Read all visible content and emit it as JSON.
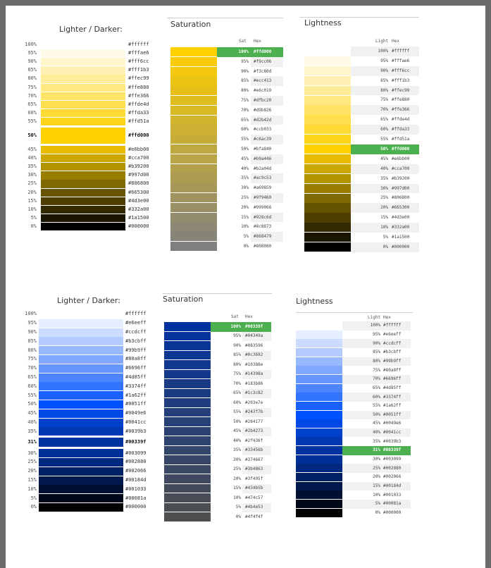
{
  "sections": [
    {
      "scale": {
        "title": "Lighter / Darker:",
        "selected": 10,
        "rows": [
          {
            "label": "100%",
            "hex": "#ffffff"
          },
          {
            "label": "95%",
            "hex": "#fffae6"
          },
          {
            "label": "90%",
            "hex": "#fff6cc"
          },
          {
            "label": "85%",
            "hex": "#fff1b3"
          },
          {
            "label": "80%",
            "hex": "#ffec99"
          },
          {
            "label": "75%",
            "hex": "#ffe880"
          },
          {
            "label": "70%",
            "hex": "#ffe366"
          },
          {
            "label": "65%",
            "hex": "#ffde4d"
          },
          {
            "label": "60%",
            "hex": "#ffda33"
          },
          {
            "label": "55%",
            "hex": "#ffd51a"
          },
          {
            "label": "50%",
            "hex": "#ffd000"
          },
          {
            "label": "45%",
            "hex": "#e6bb00"
          },
          {
            "label": "40%",
            "hex": "#cca700"
          },
          {
            "label": "35%",
            "hex": "#b39200"
          },
          {
            "label": "30%",
            "hex": "#997d00"
          },
          {
            "label": "25%",
            "hex": "#806800"
          },
          {
            "label": "20%",
            "hex": "#665300"
          },
          {
            "label": "15%",
            "hex": "#4d3e00"
          },
          {
            "label": "10%",
            "hex": "#332a00"
          },
          {
            "label": "5%",
            "hex": "#1a1500"
          },
          {
            "label": "0%",
            "hex": "#000000"
          }
        ]
      },
      "saturation": {
        "title": "Saturation",
        "col_pct": "Sat",
        "col_hex": "Hex",
        "selected": 0,
        "rows": [
          {
            "pct": "100%",
            "hex": "#ffd000",
            "color": "#ffd000"
          },
          {
            "pct": "95%",
            "hex": "#f9cc06",
            "color": "#f9cc06"
          },
          {
            "pct": "90%",
            "hex": "#f3c80d",
            "color": "#f3c80d"
          },
          {
            "pct": "85%",
            "hex": "#ecc413",
            "color": "#ecc413"
          },
          {
            "pct": "80%",
            "hex": "#e6c019",
            "color": "#e6c019"
          },
          {
            "pct": "75%",
            "hex": "#dfbc20",
            "color": "#dfbc20"
          },
          {
            "pct": "70%",
            "hex": "#d9b826",
            "color": "#d9b826"
          },
          {
            "pct": "65%",
            "hex": "#d2b42d",
            "color": "#d2b42d"
          },
          {
            "pct": "60%",
            "hex": "#ccb033",
            "color": "#ccb033"
          },
          {
            "pct": "55%",
            "hex": "#c6ac39",
            "color": "#c6ac39"
          },
          {
            "pct": "50%",
            "hex": "#bfa840",
            "color": "#bfa840"
          },
          {
            "pct": "45%",
            "hex": "#b9a446",
            "color": "#b9a446"
          },
          {
            "pct": "40%",
            "hex": "#b2a04d",
            "color": "#b2a04d"
          },
          {
            "pct": "35%",
            "hex": "#ac9c53",
            "color": "#ac9c53"
          },
          {
            "pct": "30%",
            "hex": "#a69859",
            "color": "#a69859"
          },
          {
            "pct": "25%",
            "hex": "#9f9460",
            "color": "#9f9460"
          },
          {
            "pct": "20%",
            "hex": "#999066",
            "color": "#999066"
          },
          {
            "pct": "15%",
            "hex": "#928c6d",
            "color": "#928c6d"
          },
          {
            "pct": "10%",
            "hex": "#8c8873",
            "color": "#8c8873"
          },
          {
            "pct": "5%",
            "hex": "#868479",
            "color": "#868479"
          },
          {
            "pct": "0%",
            "hex": "#808080",
            "color": "#808080"
          }
        ]
      },
      "lightness": {
        "title": "Lightness",
        "col_pct": "Light",
        "col_hex": "Hex",
        "selected": 10,
        "rows": [
          {
            "pct": "100%",
            "hex": "#ffffff"
          },
          {
            "pct": "95%",
            "hex": "#fffae6"
          },
          {
            "pct": "90%",
            "hex": "#fff6cc"
          },
          {
            "pct": "85%",
            "hex": "#fff1b3"
          },
          {
            "pct": "80%",
            "hex": "#ffec99"
          },
          {
            "pct": "75%",
            "hex": "#ffe880"
          },
          {
            "pct": "70%",
            "hex": "#ffe366"
          },
          {
            "pct": "65%",
            "hex": "#ffde4d"
          },
          {
            "pct": "60%",
            "hex": "#ffda33"
          },
          {
            "pct": "55%",
            "hex": "#ffd51a"
          },
          {
            "pct": "50%",
            "hex": "#ffd000"
          },
          {
            "pct": "45%",
            "hex": "#e6bb00"
          },
          {
            "pct": "40%",
            "hex": "#cca700"
          },
          {
            "pct": "35%",
            "hex": "#b39200"
          },
          {
            "pct": "30%",
            "hex": "#997d00"
          },
          {
            "pct": "25%",
            "hex": "#806800"
          },
          {
            "pct": "20%",
            "hex": "#665300"
          },
          {
            "pct": "15%",
            "hex": "#4d3e00"
          },
          {
            "pct": "10%",
            "hex": "#332a00"
          },
          {
            "pct": "5%",
            "hex": "#1a1500"
          },
          {
            "pct": "0%",
            "hex": "#000000"
          }
        ]
      }
    },
    {
      "scale": {
        "title": "Lighter / Darker:",
        "selected": 14,
        "rows": [
          {
            "label": "100%",
            "hex": "#ffffff"
          },
          {
            "label": "95%",
            "hex": "#e6eeff"
          },
          {
            "label": "90%",
            "hex": "#ccdcff"
          },
          {
            "label": "85%",
            "hex": "#b3cbff"
          },
          {
            "label": "80%",
            "hex": "#99b9ff"
          },
          {
            "label": "75%",
            "hex": "#80a8ff"
          },
          {
            "label": "70%",
            "hex": "#6696ff"
          },
          {
            "label": "65%",
            "hex": "#4d85ff"
          },
          {
            "label": "60%",
            "hex": "#3374ff"
          },
          {
            "label": "55%",
            "hex": "#1a62ff"
          },
          {
            "label": "50%",
            "hex": "#0051ff"
          },
          {
            "label": "45%",
            "hex": "#0049e6"
          },
          {
            "label": "40%",
            "hex": "#0041cc"
          },
          {
            "label": "35%",
            "hex": "#0039b3"
          },
          {
            "label": "31%",
            "hex": "#00339f"
          },
          {
            "label": "30%",
            "hex": "#003099"
          },
          {
            "label": "25%",
            "hex": "#002880"
          },
          {
            "label": "20%",
            "hex": "#002066"
          },
          {
            "label": "15%",
            "hex": "#00184d"
          },
          {
            "label": "10%",
            "hex": "#001033"
          },
          {
            "label": "5%",
            "hex": "#00081a"
          },
          {
            "label": "0%",
            "hex": "#000000"
          }
        ]
      },
      "saturation": {
        "title": "Saturation",
        "col_pct": "Sat",
        "col_hex": "Hex",
        "selected": 0,
        "rows": [
          {
            "pct": "100%",
            "hex": "#00339f",
            "color": "#00339f"
          },
          {
            "pct": "95%",
            "hex": "#04349a",
            "color": "#04349a"
          },
          {
            "pct": "90%",
            "hex": "#083596",
            "color": "#083596"
          },
          {
            "pct": "85%",
            "hex": "#0c3692",
            "color": "#0c3692"
          },
          {
            "pct": "80%",
            "hex": "#10388e",
            "color": "#10388e"
          },
          {
            "pct": "75%",
            "hex": "#14398a",
            "color": "#14398a"
          },
          {
            "pct": "70%",
            "hex": "#183b86",
            "color": "#183b86"
          },
          {
            "pct": "65%",
            "hex": "#1c3c82",
            "color": "#1c3c82"
          },
          {
            "pct": "60%",
            "hex": "#203e7e",
            "color": "#203e7e"
          },
          {
            "pct": "55%",
            "hex": "#243f7b",
            "color": "#243f7b"
          },
          {
            "pct": "50%",
            "hex": "#284177",
            "color": "#284177"
          },
          {
            "pct": "45%",
            "hex": "#2b4273",
            "color": "#2b4273"
          },
          {
            "pct": "40%",
            "hex": "#2f436f",
            "color": "#2f436f"
          },
          {
            "pct": "35%",
            "hex": "#33456b",
            "color": "#33456b"
          },
          {
            "pct": "30%",
            "hex": "#374667",
            "color": "#374667"
          },
          {
            "pct": "25%",
            "hex": "#3b4863",
            "color": "#3b4863"
          },
          {
            "pct": "20%",
            "hex": "#3f495f",
            "color": "#3f495f"
          },
          {
            "pct": "15%",
            "hex": "#434b5b",
            "color": "#434b5b"
          },
          {
            "pct": "10%",
            "hex": "#474c57",
            "color": "#474c57"
          },
          {
            "pct": "5%",
            "hex": "#4b4e53",
            "color": "#4b4e53"
          },
          {
            "pct": "0%",
            "hex": "#4f4f4f",
            "color": "#4f4f4f"
          }
        ]
      },
      "lightness": {
        "title": "Lightness",
        "col_pct": "Light",
        "col_hex": "Hex",
        "selected": 14,
        "rows": [
          {
            "pct": "100%",
            "hex": "#ffffff"
          },
          {
            "pct": "95%",
            "hex": "#e6eeff"
          },
          {
            "pct": "90%",
            "hex": "#ccdcff"
          },
          {
            "pct": "85%",
            "hex": "#b3cbff"
          },
          {
            "pct": "80%",
            "hex": "#99b9ff"
          },
          {
            "pct": "75%",
            "hex": "#80a8ff"
          },
          {
            "pct": "70%",
            "hex": "#6696ff"
          },
          {
            "pct": "65%",
            "hex": "#4d85ff"
          },
          {
            "pct": "60%",
            "hex": "#3374ff"
          },
          {
            "pct": "55%",
            "hex": "#1a62ff"
          },
          {
            "pct": "50%",
            "hex": "#0051ff"
          },
          {
            "pct": "45%",
            "hex": "#0049e6"
          },
          {
            "pct": "40%",
            "hex": "#0041cc"
          },
          {
            "pct": "35%",
            "hex": "#0039b3"
          },
          {
            "pct": "31%",
            "hex": "#00339f"
          },
          {
            "pct": "30%",
            "hex": "#003099"
          },
          {
            "pct": "25%",
            "hex": "#002880"
          },
          {
            "pct": "20%",
            "hex": "#002066"
          },
          {
            "pct": "15%",
            "hex": "#00184d"
          },
          {
            "pct": "10%",
            "hex": "#001033"
          },
          {
            "pct": "5%",
            "hex": "#00081a"
          },
          {
            "pct": "0%",
            "hex": "#000000"
          }
        ]
      }
    }
  ]
}
